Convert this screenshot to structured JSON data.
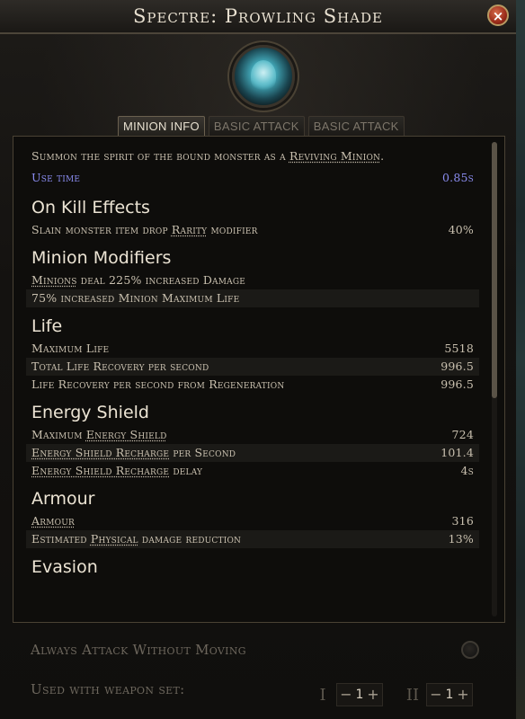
{
  "window": {
    "title": "Spectre: Prowling Shade",
    "close_label": "×"
  },
  "skill_icon": "spectre-skull-icon",
  "tabs": [
    {
      "label": "Minion Info",
      "active": true
    },
    {
      "label": "Basic Attack",
      "active": false
    },
    {
      "label": "Basic Attack",
      "active": false
    }
  ],
  "description": {
    "prefix": "Summon the spirit of the bound monster as a ",
    "link": "Reviving Minion",
    "suffix": "."
  },
  "use_time": {
    "label": "Use time",
    "value": "0.85s"
  },
  "sections": {
    "on_kill": {
      "heading": "On Kill Effects",
      "rows": [
        {
          "pre": "Slain monster item drop ",
          "link": "Rarity",
          "post": " modifier",
          "value": "40%"
        }
      ]
    },
    "minion_mods": {
      "heading": "Minion Modifiers",
      "rows": [
        {
          "pre": "",
          "link": "Minions",
          "post": " deal 225% increased Damage",
          "value": ""
        },
        {
          "pre": "75% increased Minion Maximum Life",
          "link": "",
          "post": "",
          "value": ""
        }
      ]
    },
    "life": {
      "heading": "Life",
      "rows": [
        {
          "pre": "Maximum Life",
          "link": "",
          "post": "",
          "value": "5518"
        },
        {
          "pre": "Total Life Recovery per second",
          "link": "",
          "post": "",
          "value": "996.5"
        },
        {
          "pre": "Life Recovery per second from Regeneration",
          "link": "",
          "post": "",
          "value": "996.5"
        }
      ]
    },
    "energy_shield": {
      "heading": "Energy Shield",
      "rows": [
        {
          "pre": "Maximum ",
          "link": "Energy Shield",
          "post": "",
          "value": "724"
        },
        {
          "pre": "",
          "link": "Energy Shield Recharge",
          "post": " per Second",
          "value": "101.4"
        },
        {
          "pre": "",
          "link": "Energy Shield Recharge",
          "post": " delay",
          "value": "4s"
        }
      ]
    },
    "armour": {
      "heading": "Armour",
      "rows": [
        {
          "pre": "",
          "link": "Armour",
          "post": "",
          "value": "316"
        },
        {
          "pre": "Estimated ",
          "link": "Physical",
          "post": " damage reduction",
          "value": "13%"
        }
      ]
    },
    "evasion": {
      "heading": "Evasion"
    }
  },
  "scroll": {
    "position": 0.0,
    "visible_fraction": 0.54
  },
  "footer": {
    "always_attack_label": "Always Attack Without Moving",
    "always_attack_enabled": false,
    "weapon_set_label": "Used with weapon set:",
    "weapon_sets": [
      {
        "numeral": "I",
        "minus": "−",
        "value": "1",
        "plus": "+"
      },
      {
        "numeral": "II",
        "minus": "−",
        "value": "1",
        "plus": "+"
      }
    ]
  },
  "colors": {
    "use_time": "#8a8cf0",
    "heading": "#ece4d4",
    "text": "#c9c0af",
    "close_button": "#9a2c1a"
  }
}
